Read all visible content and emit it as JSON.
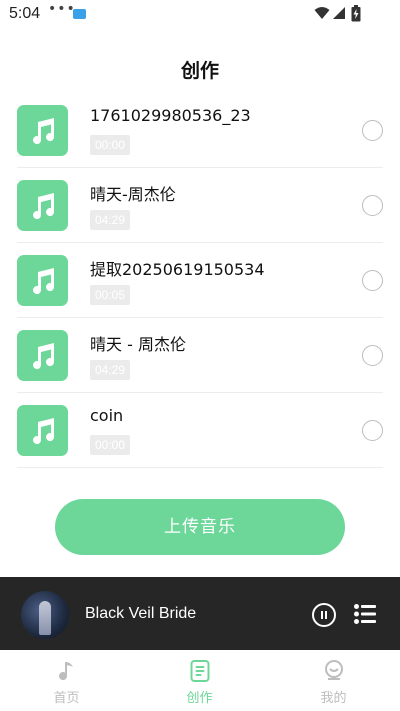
{
  "status_bar": {
    "time": "5:04",
    "dots": "•••"
  },
  "page": {
    "title": "创作"
  },
  "tracks": [
    {
      "name": "1761029980536_23",
      "duration": "00:00"
    },
    {
      "name": "晴天-周杰伦",
      "duration": "04:29"
    },
    {
      "name": "提取20250619150534",
      "duration": "00:05"
    },
    {
      "name": "晴天 - 周杰伦",
      "duration": "04:29"
    },
    {
      "name": "coin",
      "duration": "00:00"
    }
  ],
  "upload": {
    "label": "上传音乐"
  },
  "player": {
    "title": "Black Veil Bride",
    "state": "playing"
  },
  "tabs": [
    {
      "label": "首页",
      "icon": "music-note-icon",
      "active": false
    },
    {
      "label": "创作",
      "icon": "document-icon",
      "active": true
    },
    {
      "label": "我的",
      "icon": "profile-icon",
      "active": false
    }
  ],
  "colors": {
    "accent": "#6cd799",
    "player_bg": "#262626",
    "inactive": "#bdbdbd"
  }
}
